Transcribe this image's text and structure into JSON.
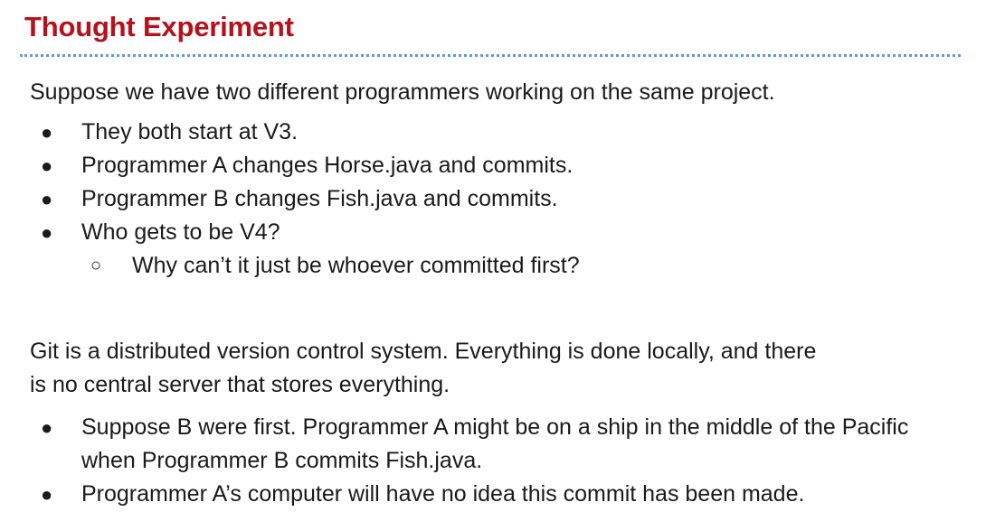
{
  "title": "Thought Experiment",
  "intro": "Suppose we have two different programmers working on the same project.",
  "bullets": [
    "They both start at V3.",
    "Programmer A changes Horse.java and commits.",
    "Programmer B changes Fish.java and commits.",
    "Who gets to be V4?"
  ],
  "sub_bullet": "Why can’t it just be whoever committed first?",
  "paragraph_line1": "Git is a distributed version control system. Everything is done locally, and there",
  "paragraph_line2": "is no central server that stores everything.",
  "bullets2": [
    "Suppose B were first. Programmer A might be on a ship in the middle of the Pacific when Programmer B commits Fish.java.",
    "Programmer A’s computer will have no idea this commit has been made."
  ],
  "markers": {
    "filled": "●",
    "hollow": "○"
  },
  "colors": {
    "title": "#b5121b",
    "rule": "#5b9bd5",
    "text": "#1a1a1a"
  }
}
